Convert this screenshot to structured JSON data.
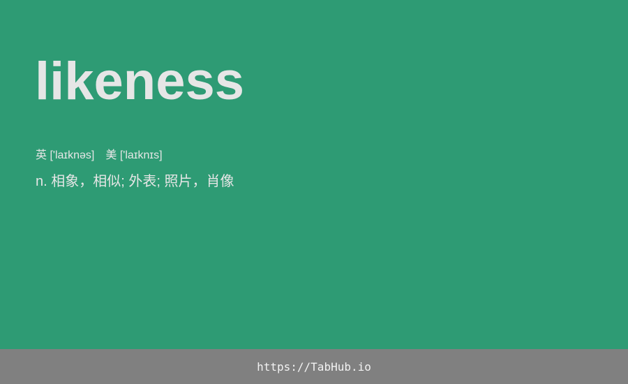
{
  "card": {
    "word": "likeness",
    "phonetics": [
      {
        "label": "英",
        "ipa": "['laɪknəs]"
      },
      {
        "label": "美",
        "ipa": "['laɪknɪs]"
      }
    ],
    "definition": "n. 相象，相似; 外表; 照片，肖像"
  },
  "footer": {
    "link_text": "https://TabHub.io"
  },
  "colors": {
    "background": "#2e9b74",
    "footer_background": "#808080",
    "text": "#e6e6e6"
  }
}
